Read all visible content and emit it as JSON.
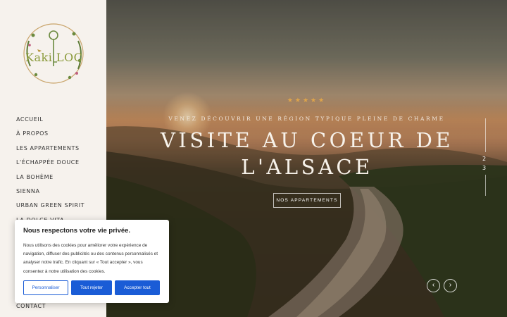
{
  "logo": {
    "text": "Kaki LOC"
  },
  "nav": {
    "items": [
      {
        "label": "ACCUEIL"
      },
      {
        "label": "À PROPOS"
      },
      {
        "label": "LES APPARTEMENTS"
      },
      {
        "label": "L'ÉCHAPPÉE DOUCE"
      },
      {
        "label": "LA BOHÈME"
      },
      {
        "label": "SIENNA"
      },
      {
        "label": "URBAN GREEN SPIRIT"
      },
      {
        "label": "LA DOLCE VITA"
      }
    ],
    "contact": "CONTACT"
  },
  "hero": {
    "stars": "★★★★★",
    "rating": 5,
    "tagline": "VENEZ DÉCOUVRIR UNE RÉGION TYPIQUE PLEINE DE CHARME",
    "headline": "VISITE AU COEUR DE L'ALSACE",
    "cta_label": "NOS APPARTEMENTS",
    "slides": [
      "2",
      "3"
    ],
    "prev_icon": "‹",
    "next_icon": "›"
  },
  "cookie": {
    "title": "Nous respectons votre vie privée.",
    "body": "Nous utilisons des cookies pour améliorer votre expérience de navigation, diffuser des publicités ou des contenus personnalisés et analyser notre trafic. En cliquant sur « Tout accepter », vous consentez à notre utilisation des cookies.",
    "customize_label": "Personnaliser",
    "reject_label": "Tout rejeter",
    "accept_label": "Accepter tout"
  },
  "colors": {
    "accent_blue": "#1a5cd6",
    "star_gold": "#e0a54a",
    "sidebar_bg": "#f6f2ed",
    "logo_green": "#8a9a3a"
  }
}
